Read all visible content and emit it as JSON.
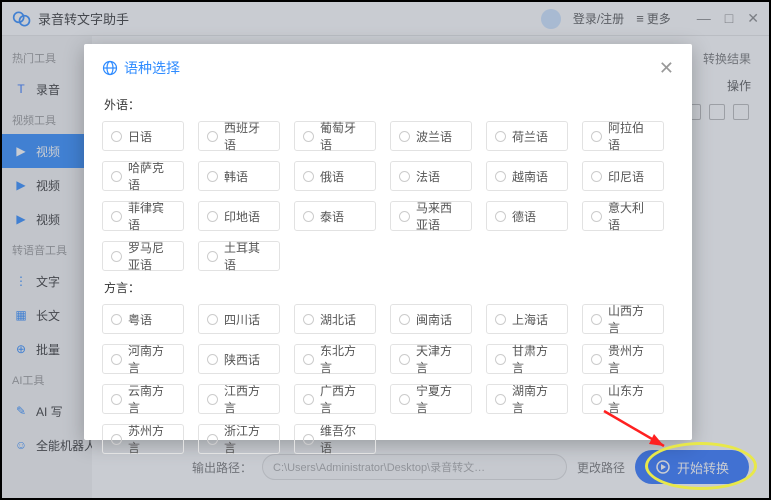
{
  "app": {
    "title": "录音转文字助手"
  },
  "titlebar": {
    "login": "登录/注册",
    "more": "更多"
  },
  "sidebar": {
    "sections": [
      {
        "label": "热门工具",
        "items": [
          {
            "label": "录音",
            "icon": "T",
            "color": "#2e73ff"
          }
        ]
      },
      {
        "label": "视频工具",
        "items": [
          {
            "label": "视频",
            "icon": "▶",
            "color": "#fff",
            "active": true
          },
          {
            "label": "视频",
            "icon": "▶",
            "color": "#2e8bff"
          },
          {
            "label": "视频",
            "icon": "▶",
            "color": "#2e8bff"
          }
        ]
      },
      {
        "label": "转语音工具",
        "items": [
          {
            "label": "文字",
            "icon": "⋮",
            "color": "#2e8bff"
          },
          {
            "label": "长文",
            "icon": "▦",
            "color": "#2e8bff"
          },
          {
            "label": "批量",
            "icon": "⊕",
            "color": "#2e8bff"
          }
        ]
      },
      {
        "label": "AI工具",
        "items": [
          {
            "label": "AI 写",
            "icon": "✎",
            "color": "#2e8bff"
          },
          {
            "label": "全能机器人",
            "icon": "☺",
            "color": "#2e8bff"
          }
        ]
      }
    ]
  },
  "content_top": {
    "tab_result": "转换结果",
    "op": "操作"
  },
  "output": {
    "label": "输出路径：",
    "path": "C:\\Users\\Administrator\\Desktop\\录音转文…",
    "change": "更改路径"
  },
  "start_btn": "开始转换",
  "modal": {
    "title": "语种选择",
    "group_foreign": "外语：",
    "group_dialect": "方言：",
    "foreign": [
      "日语",
      "西班牙语",
      "葡萄牙语",
      "波兰语",
      "荷兰语",
      "阿拉伯语",
      "哈萨克语",
      "韩语",
      "俄语",
      "法语",
      "越南语",
      "印尼语",
      "菲律宾语",
      "印地语",
      "泰语",
      "马来西亚语",
      "德语",
      "意大利语",
      "罗马尼亚语",
      "土耳其语"
    ],
    "dialect": [
      "粤语",
      "四川话",
      "湖北话",
      "闽南话",
      "上海话",
      "山西方言",
      "河南方言",
      "陕西话",
      "东北方言",
      "天津方言",
      "甘肃方言",
      "贵州方言",
      "云南方言",
      "江西方言",
      "广西方言",
      "宁夏方言",
      "湖南方言",
      "山东方言",
      "苏州方言",
      "浙江方言",
      "维吾尔语"
    ]
  }
}
